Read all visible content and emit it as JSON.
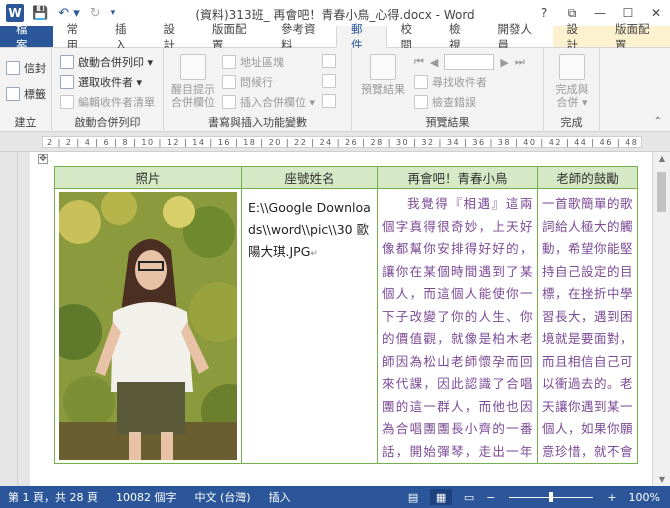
{
  "window": {
    "title": "(資料)313班_ 再會吧！青春小鳥_心得.docx - Word",
    "app_logo": "W",
    "controls": [
      "?",
      "⧉",
      "—",
      "☐",
      "✕"
    ]
  },
  "ribbon_tabs": [
    "檔案",
    "常用",
    "插入",
    "設計",
    "版面配置",
    "參考資料",
    "郵件",
    "校閱",
    "檢視",
    "開發人員",
    "設計",
    "版面配置"
  ],
  "ribbon": {
    "group_create": {
      "label": "建立",
      "envelopes": "信封",
      "labels": "標籤"
    },
    "group_start": {
      "label": "啟動合併列印",
      "start": "啟動合併列印 ▾",
      "select": "選取收件者 ▾",
      "edit": "編輯收件者清單"
    },
    "group_write": {
      "label": "書寫與插入功能變數",
      "highlight": "醒目提示\n合併欄位",
      "address": "地址區塊",
      "greeting": "問候行",
      "insert_field": "插入合併欄位 ▾"
    },
    "group_preview": {
      "label": "預覽結果",
      "preview": "預覽結果",
      "find": "尋找收件者",
      "check": "檢查錯誤"
    },
    "group_finish": {
      "label": "完成",
      "finish": "完成與\n合併 ▾"
    }
  },
  "ruler_text": "2 | 2 | 4 | 6 | 8 | 10 | 12 | 14 | 16 | 18 | 20 | 22 | 24 | 26 | 28 | 30 | 32 | 34 | 36 | 38 | 40 | 42 | 44 | 46 | 48 | 50",
  "table": {
    "headers": [
      "照片",
      "座號姓名",
      "再會吧！青春小鳥",
      "老師的鼓勵"
    ],
    "path": "E:\\\\Google Downloads\\\\word\\\\pic\\\\30 歐陽大琪.JPG",
    "essay": "我覺得『相遇』這兩個字真得很奇妙，上天好像都幫你安排得好好的，讓你在某個時間遇到了某個人，而這個人能使你一下子改變了你的人生、你的價值觀，就像是柏木老師因為松山老師懷孕而回來代課，因此認識了合唱團的這一群人，而他也因為合唱團團長小齊的一番話，開始彈琴，走出一年前失去摯愛的陰影，不再毒",
    "encouragement": "一首歌簡單的歌詞給人極大的觸動，希望你能堅持自己設定的目標，在挫折中學習長大，遇到困境就是要面對，而且相信自己可以衝過去的。老天讓你遇到某一個人，如果你願意珍惜，就不會錯"
  },
  "status": {
    "page": "第 1 頁，共 28 頁",
    "words": "10082 個字",
    "lang": "中文 (台灣)",
    "mode": "插入",
    "zoom": "100%",
    "zoom_level": 0.5
  },
  "colors": {
    "accent": "#2b579a",
    "table_border": "#76b04e",
    "table_header": "#d6e9c6",
    "essay_text": "#7b4b96"
  }
}
